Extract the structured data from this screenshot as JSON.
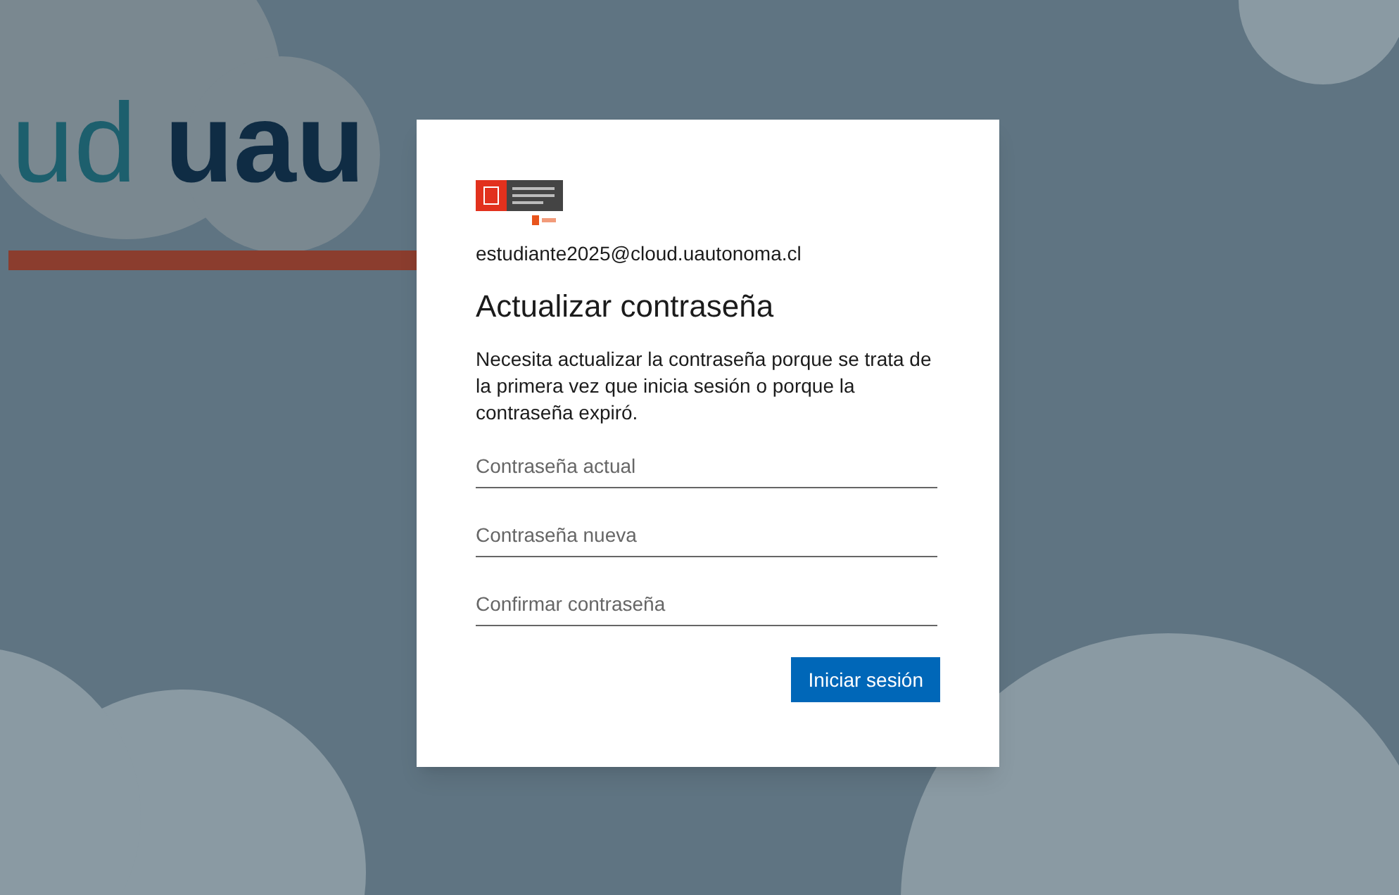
{
  "background": {
    "brand_parts": [
      "ud",
      "uau"
    ]
  },
  "dialog": {
    "account": "estudiante2025@cloud.uautonoma.cl",
    "title": "Actualizar contraseña",
    "message": "Necesita actualizar la contraseña porque se trata de la primera vez que inicia sesión o porque la contraseña expiró.",
    "fields": [
      {
        "placeholder": "Contraseña actual"
      },
      {
        "placeholder": "Contraseña nueva"
      },
      {
        "placeholder": "Confirmar contraseña"
      }
    ],
    "button": "Iniciar sesión"
  }
}
